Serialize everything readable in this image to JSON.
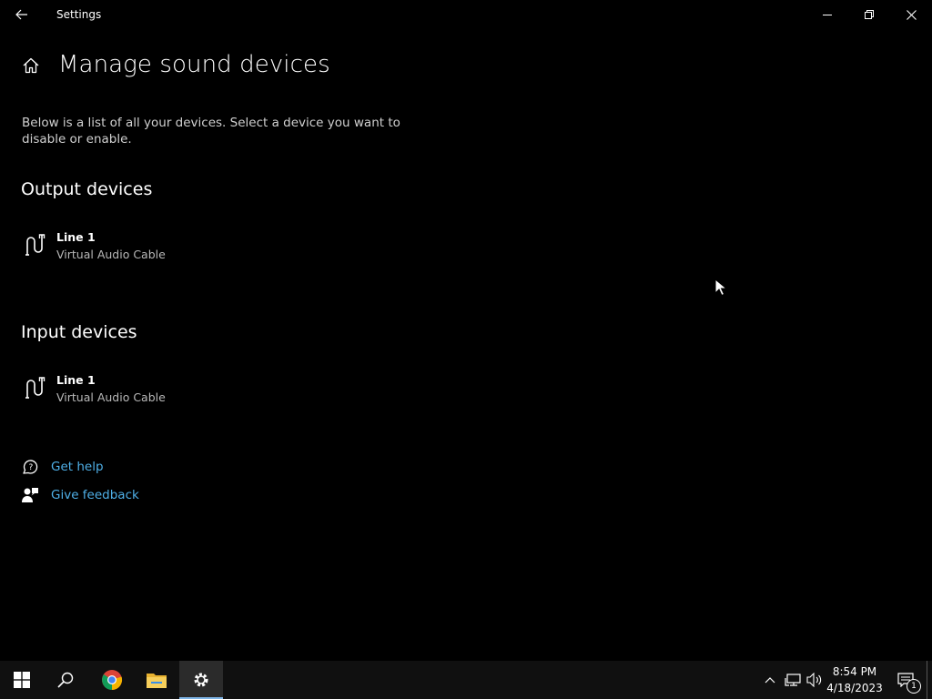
{
  "window": {
    "title": "Settings",
    "controls": [
      "minimize-icon",
      "restore-icon",
      "close-icon"
    ]
  },
  "page": {
    "title": "Manage sound devices",
    "description": "Below is a list of all your devices. Select a device you want to disable or enable."
  },
  "output": {
    "heading": "Output devices",
    "devices": [
      {
        "name": "Line 1",
        "subtitle": "Virtual Audio Cable",
        "icon": "audio-jack-icon"
      }
    ]
  },
  "input": {
    "heading": "Input devices",
    "devices": [
      {
        "name": "Line 1",
        "subtitle": "Virtual Audio Cable",
        "icon": "audio-jack-icon"
      }
    ]
  },
  "help": {
    "get_help": "Get help",
    "give_feedback": "Give feedback"
  },
  "taskbar": {
    "apps": [
      "windows-start-icon",
      "search-icon",
      "chrome-icon",
      "file-explorer-icon",
      "settings-gear-icon"
    ],
    "time": "8:54 PM",
    "date": "4/18/2023",
    "notification_count": "1"
  },
  "colors": {
    "background": "#000000",
    "link": "#4fb0e8",
    "taskbar": "#101010",
    "active_indicator": "#7fb6e8"
  }
}
